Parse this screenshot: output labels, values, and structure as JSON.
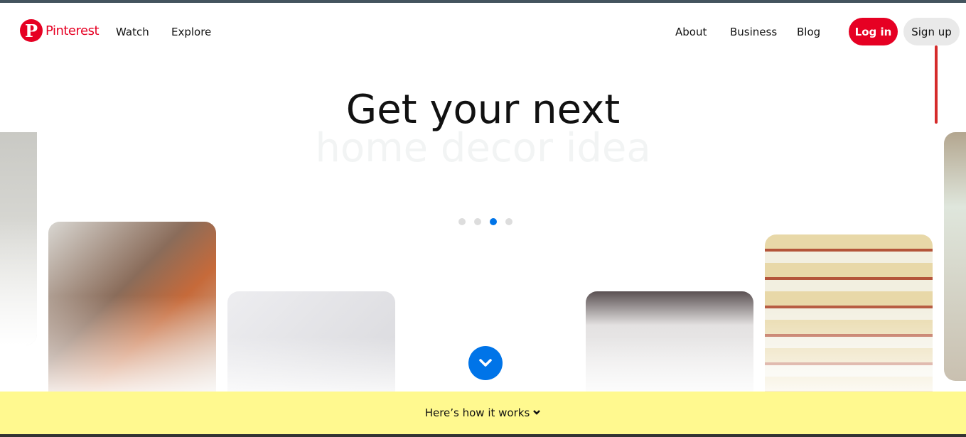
{
  "header": {
    "brand": "Pinterest",
    "nav_left": [
      "Watch",
      "Explore"
    ],
    "nav_right": [
      "About",
      "Business",
      "Blog"
    ],
    "login": "Log in",
    "signup": "Sign up"
  },
  "hero": {
    "title": "Get your next",
    "subtitle": "home decor idea",
    "carousel_dots": 4,
    "active_dot": 3
  },
  "footer": {
    "how_it_works": "Here’s how it works"
  },
  "colors": {
    "brand": "#e60023",
    "accent": "#0074e8",
    "footer_bg": "#fff98f"
  }
}
